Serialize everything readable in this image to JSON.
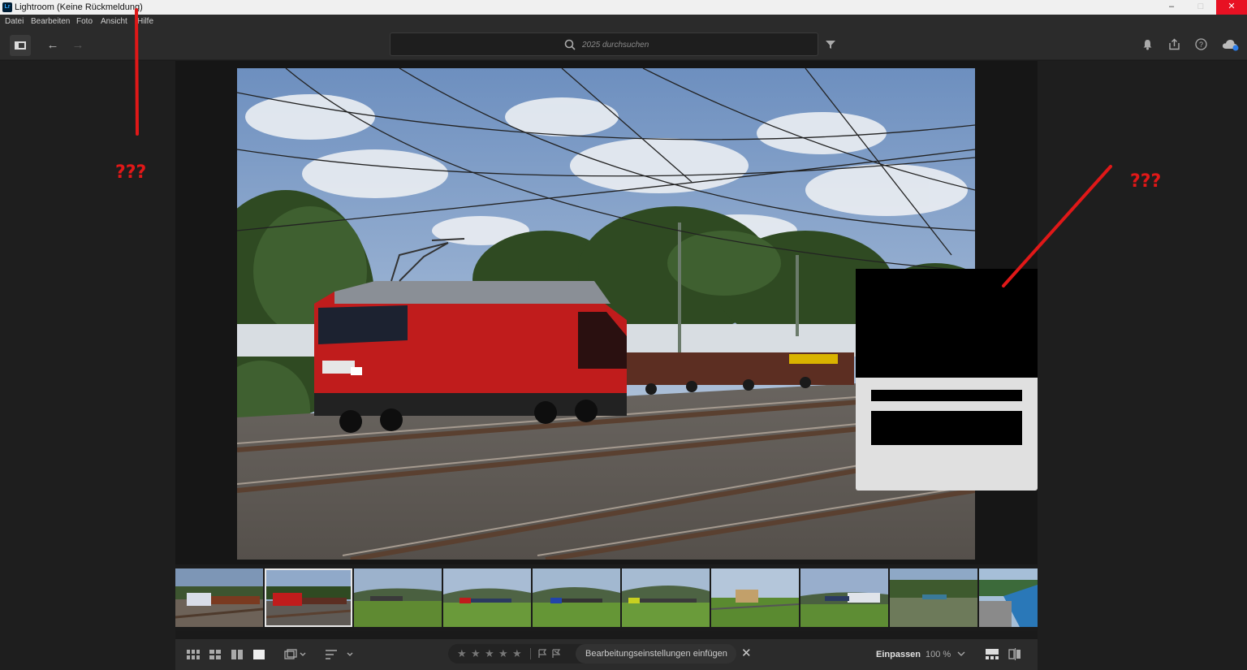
{
  "window": {
    "title": "Lightroom (Keine Rückmeldung)",
    "app_icon": "Lr",
    "controls": [
      "minimize-icon",
      "maximize-icon",
      "close-icon"
    ]
  },
  "menu": {
    "items": [
      "Datei",
      "Bearbeiten",
      "Foto",
      "Ansicht",
      "Hilfe"
    ]
  },
  "toolbar": {
    "search_placeholder": "2025 durchsuchen",
    "icons": [
      "panel-toggle-icon",
      "back-arrow-icon",
      "forward-arrow-icon",
      "search-icon",
      "filter-icon",
      "bell-icon",
      "share-icon",
      "help-icon",
      "cloud-sync-icon"
    ]
  },
  "annotations": {
    "left_mark": "???",
    "right_mark": "???",
    "color": "#e01818"
  },
  "filmstrip": {
    "selected_index": 1,
    "count": 10
  },
  "bottom": {
    "paste_label": "Bearbeitungseinstellungen einfügen",
    "fit_label": "Einpassen",
    "zoom_label": "100 %",
    "rating_stars": 5
  },
  "colors": {
    "accent_close": "#e81123",
    "background": "#1a1a1a"
  }
}
